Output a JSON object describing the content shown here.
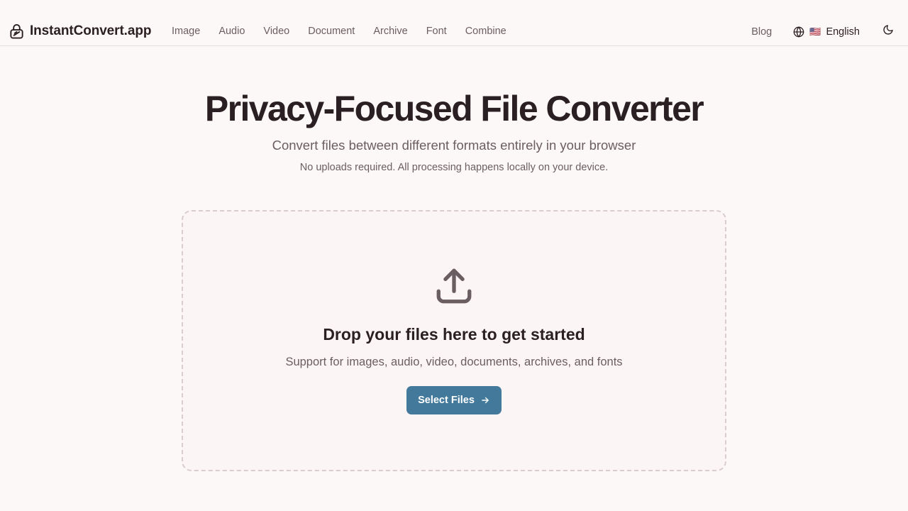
{
  "brand": {
    "name": "InstantConvert.app",
    "icon": "lock-icon"
  },
  "nav": {
    "items": [
      {
        "label": "Image"
      },
      {
        "label": "Audio"
      },
      {
        "label": "Video"
      },
      {
        "label": "Document"
      },
      {
        "label": "Archive"
      },
      {
        "label": "Font"
      },
      {
        "label": "Combine"
      }
    ]
  },
  "header_right": {
    "blog": "Blog",
    "language": {
      "flag": "🇺🇸",
      "label": "English",
      "icon": "globe-icon"
    },
    "theme_icon": "moon-icon"
  },
  "hero": {
    "title": "Privacy-Focused File Converter",
    "subtitle": "Convert files between different formats entirely in your browser",
    "note": "No uploads required. All processing happens locally on your device."
  },
  "dropzone": {
    "icon": "upload-icon",
    "heading": "Drop your files here to get started",
    "support": "Support for images, audio, video, documents, archives, and fonts",
    "button_label": "Select Files"
  },
  "colors": {
    "background": "#fdf8f8",
    "accent": "#437a9c",
    "text": "#2a1f22",
    "muted": "#6b5e62"
  }
}
